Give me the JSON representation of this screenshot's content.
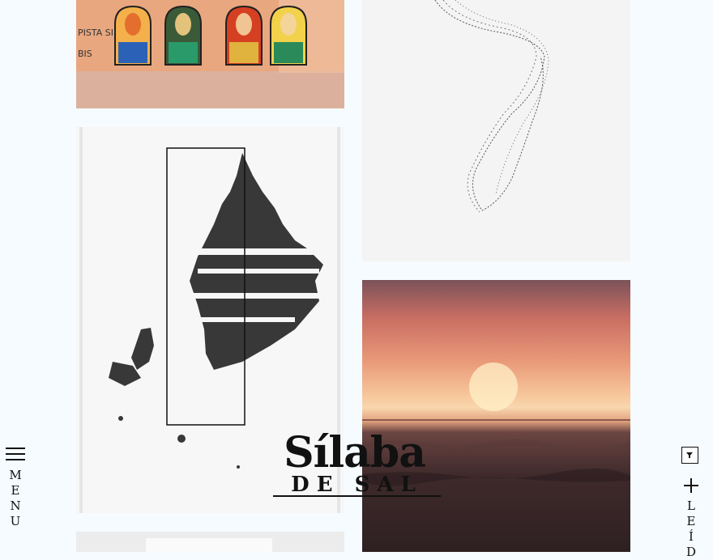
{
  "gallery": {
    "items": [
      {
        "id": "pins",
        "alt": "Mona Lisa enamel pins"
      },
      {
        "id": "map",
        "alt": "Map illustration"
      },
      {
        "id": "sculpture",
        "alt": "Wire sculpture"
      },
      {
        "id": "sunset",
        "alt": "Sunset over sea"
      },
      {
        "id": "bottom-left",
        "alt": ""
      }
    ],
    "pins_wall_text": "PISTA SIM\nBIS"
  },
  "logo": {
    "line1": "Sílaba",
    "line2": "DE SAL"
  },
  "nav": {
    "menu_letters": [
      "M",
      "E",
      "N",
      "U"
    ],
    "read_letters": [
      "L",
      "E",
      "Í",
      "D"
    ]
  },
  "colors": {
    "background": "#f5fbff",
    "ink": "#111111"
  }
}
